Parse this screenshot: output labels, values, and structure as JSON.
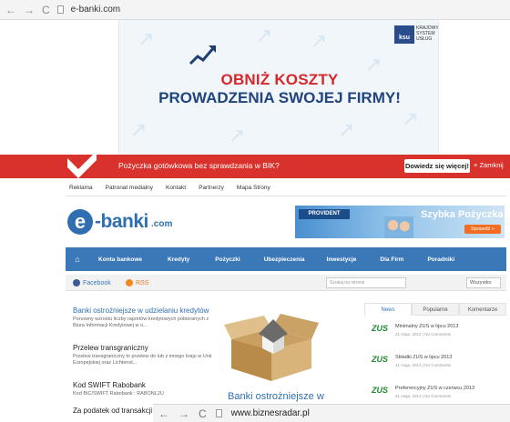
{
  "browser_top": {
    "back": "←",
    "forward": "→",
    "reload": "C",
    "url": "e-banki.com"
  },
  "banner": {
    "headline1": "OBNIŻ KOSZTY",
    "headline2": "PROWADZENIA SWOJEJ FIRMY!",
    "ksu_box": "ksu",
    "ksu_text": "KRAJOWY SYSTEM USŁUG"
  },
  "redbar": {
    "text": "Pożyczka gotówkowa bez sprawdzania w BIK?",
    "button": "Dowiedz się więcej!",
    "close": "× Zamknij"
  },
  "toplinks": [
    "Reklama",
    "Patronat medialny",
    "Kontakt",
    "Partnerzy",
    "Mapa Strony"
  ],
  "logo": {
    "e": "e",
    "word": "-banki",
    "com": ".com"
  },
  "provident": {
    "brand": "PROVIDENT",
    "heading": "Szybka Pożyczka",
    "button": "Sprawdź »"
  },
  "menu": {
    "home_icon": "⌂",
    "items": [
      "Konta bankowe",
      "Kredyty",
      "Pożyczki",
      "Ubezpieczenia",
      "Inwestycje",
      "Dla Firm",
      "Poradniki"
    ]
  },
  "social": {
    "facebook": "Facebook",
    "rss": "RSS",
    "search_placeholder": "Szukaj na stronie",
    "select_value": "Wszystko",
    "go": "⚲"
  },
  "articles": [
    {
      "title": "Banki ostrożniejsze w udzielaniu kredytów",
      "desc": "Ponowny wzrostu liczby raportów kredytowych pobieranych z Biura Informacji Kredytowej w o..."
    },
    {
      "title": "Przelew transgraniczny",
      "desc": "Przelew transgraniczny to przelew do lub z innego kraju w Unii Europejskiej oraz Lichtenst..."
    },
    {
      "title": "Kod SWIFT Rabobank",
      "desc": "Kod BIC/SWIFT Rabobank : RABONL2U"
    },
    {
      "title": "Za podatek od transakcji",
      "desc": ""
    }
  ],
  "featured_title": "Banki ostrożniejsze w",
  "tabs": [
    "News",
    "Popularne",
    "Komentarze"
  ],
  "news": [
    {
      "logo": "ZUS",
      "title": "Minimalny ZUS w lipcu 2013",
      "meta": "21 maja, 2013 | No Comments"
    },
    {
      "logo": "ZUS",
      "title": "Składki ZUS w lipcu 2013",
      "meta": "21 maja, 2013 | No Comments"
    },
    {
      "logo": "ZUS",
      "title": "Preferencyjny ZUS w czerwcu 2013",
      "meta": "21 maja, 2013 | No Comments"
    }
  ],
  "browser_bottom": {
    "back": "←",
    "forward": "→",
    "reload": "C",
    "url": "www.biznesradar.pl"
  }
}
